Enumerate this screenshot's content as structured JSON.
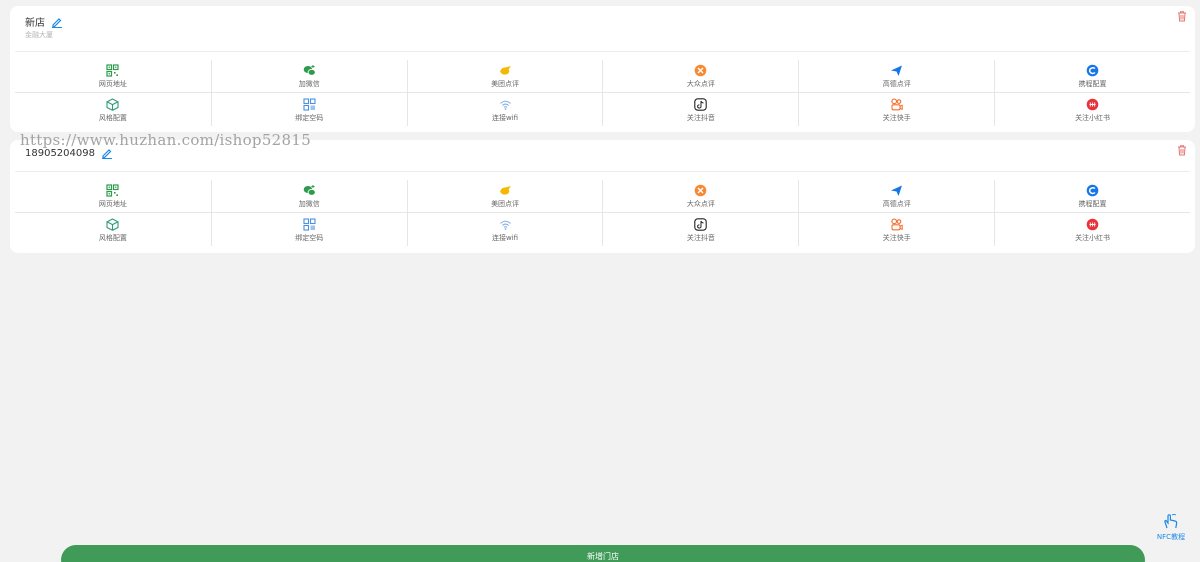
{
  "stores": [
    {
      "name": "新店",
      "subtitle": "金融大厦"
    },
    {
      "name": "18905204098",
      "subtitle": ""
    }
  ],
  "actions": [
    {
      "label": "网页地址",
      "icon": "qrcode-icon",
      "color": "#2e9a4e"
    },
    {
      "label": "加微信",
      "icon": "wechat-icon",
      "color": "#2e9a4e"
    },
    {
      "label": "美团点评",
      "icon": "meituan-icon",
      "color": "#f5b800"
    },
    {
      "label": "大众点评",
      "icon": "dianping-icon",
      "color": "#f58a33"
    },
    {
      "label": "高德点评",
      "icon": "amap-icon",
      "color": "#1676e8"
    },
    {
      "label": "携程配置",
      "icon": "ctrip-icon",
      "color": "#1676e8"
    },
    {
      "label": "风格配置",
      "icon": "cube-icon",
      "color": "#2e9a7a"
    },
    {
      "label": "绑定空码",
      "icon": "bind-code-icon",
      "color": "#4a90e2"
    },
    {
      "label": "连接wifi",
      "icon": "wifi-icon",
      "color": "#7fb0e6"
    },
    {
      "label": "关注抖音",
      "icon": "douyin-icon",
      "color": "#222222"
    },
    {
      "label": "关注快手",
      "icon": "kuaishou-icon",
      "color": "#f56c2d"
    },
    {
      "label": "关注小红书",
      "icon": "xiaohongshu-icon",
      "color": "#e8323c"
    }
  ],
  "watermark": "https://www.huzhan.com/ishop52815",
  "nfc_label": "NFC教程",
  "add_store_label": "新增门店",
  "colors": {
    "accent_green": "#3f9b57",
    "delete_red": "#e57373",
    "edit_blue": "#1e88e5"
  }
}
